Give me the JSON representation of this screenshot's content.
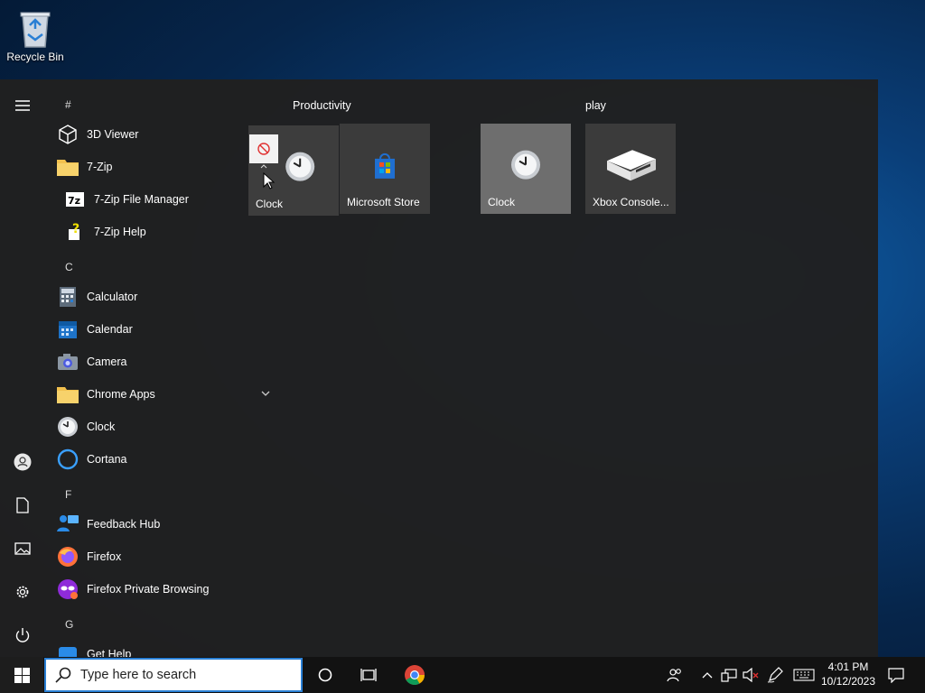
{
  "desktop": {
    "recycle_bin_label": "Recycle Bin"
  },
  "start_menu": {
    "app_list": {
      "groups": [
        {
          "letter": "#",
          "apps": [
            {
              "label": "3D Viewer",
              "icon": "cube-icon"
            },
            {
              "label": "7-Zip",
              "icon": "folder-icon"
            },
            {
              "label": "7-Zip File Manager",
              "icon": "7zip-icon"
            },
            {
              "label": "7-Zip Help",
              "icon": "help-icon"
            }
          ]
        },
        {
          "letter": "C",
          "apps": [
            {
              "label": "Calculator",
              "icon": "calculator-icon"
            },
            {
              "label": "Calendar",
              "icon": "calendar-icon"
            },
            {
              "label": "Camera",
              "icon": "camera-icon"
            },
            {
              "label": "Chrome Apps",
              "icon": "folder-icon"
            },
            {
              "label": "Clock",
              "icon": "clock-icon"
            },
            {
              "label": "Cortana",
              "icon": "cortana-icon"
            }
          ]
        },
        {
          "letter": "F",
          "apps": [
            {
              "label": "Feedback Hub",
              "icon": "feedback-icon"
            },
            {
              "label": "Firefox",
              "icon": "firefox-icon"
            },
            {
              "label": "Firefox Private Browsing",
              "icon": "firefox-private-icon"
            }
          ]
        },
        {
          "letter": "G",
          "apps": [
            {
              "label": "Get Help",
              "icon": "get-help-icon"
            }
          ]
        }
      ]
    },
    "tile_groups": [
      {
        "title": "Productivity",
        "tiles": [
          {
            "label": "Clock"
          },
          {
            "label": "Microsoft Store"
          }
        ]
      },
      {
        "title": "play",
        "tiles": [
          {
            "label": "Clock"
          },
          {
            "label": "Xbox Console..."
          }
        ]
      }
    ]
  },
  "taskbar": {
    "search_placeholder": "Type here to search",
    "time": "4:01 PM",
    "date": "10/12/2023"
  }
}
